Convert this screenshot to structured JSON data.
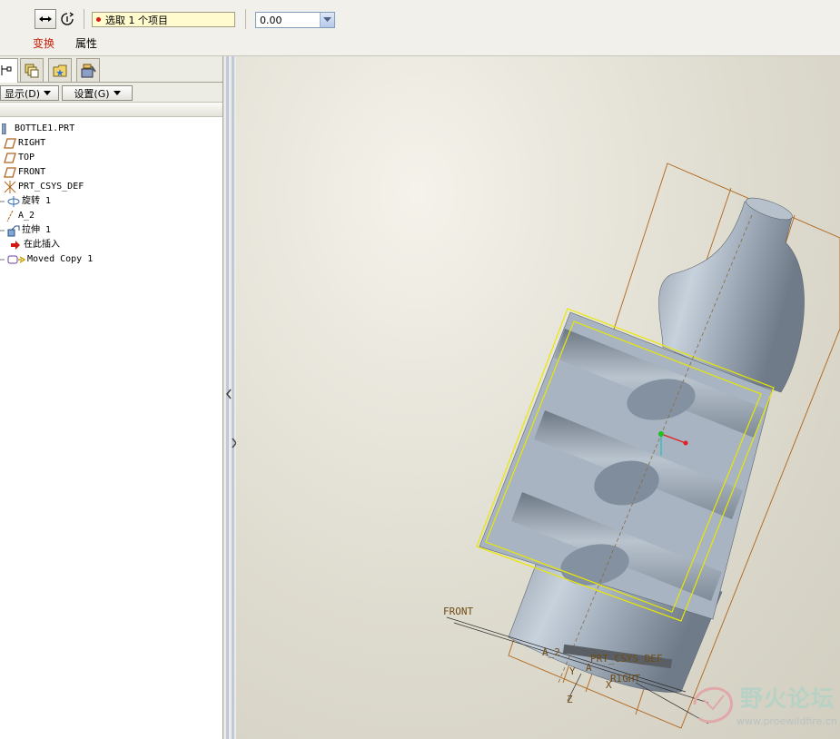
{
  "dashboard": {
    "selection_text": "选取 1 个项目",
    "value": "0.00",
    "tabs": [
      "变换",
      "属性"
    ],
    "accent": "#c9200e"
  },
  "panel": {
    "show_label": "显示(D)",
    "settings_label": "设置(G)",
    "tree": [
      {
        "label": "BOTTLE1.PRT",
        "icon": "part-icon"
      },
      {
        "label": "RIGHT",
        "icon": "datum-plane-icon"
      },
      {
        "label": "TOP",
        "icon": "datum-plane-icon"
      },
      {
        "label": "FRONT",
        "icon": "datum-plane-icon"
      },
      {
        "label": "PRT_CSYS_DEF",
        "icon": "csys-icon"
      },
      {
        "label": "旋转 1",
        "icon": "revolve-icon"
      },
      {
        "label": "A_2",
        "icon": "axis-icon"
      },
      {
        "label": "拉伸 1",
        "icon": "extrude-icon"
      },
      {
        "label": "在此插入",
        "icon": "insert-arrow-icon"
      },
      {
        "label": "Moved Copy 1",
        "icon": "moved-copy-icon"
      }
    ]
  },
  "graphics": {
    "datum_labels": {
      "front": "FRONT",
      "a2": "A_2",
      "csys": "PRT_CSYS_DEF",
      "right": "RIGHT",
      "y": "Y",
      "a": "A",
      "z": "Z",
      "x": "X"
    },
    "watermark_title": "野火论坛",
    "watermark_url": "www.proewildfire.cn",
    "colors": {
      "body": "#a9b6c4",
      "datum": "#b0641a",
      "highlight": "#e8e800"
    }
  }
}
